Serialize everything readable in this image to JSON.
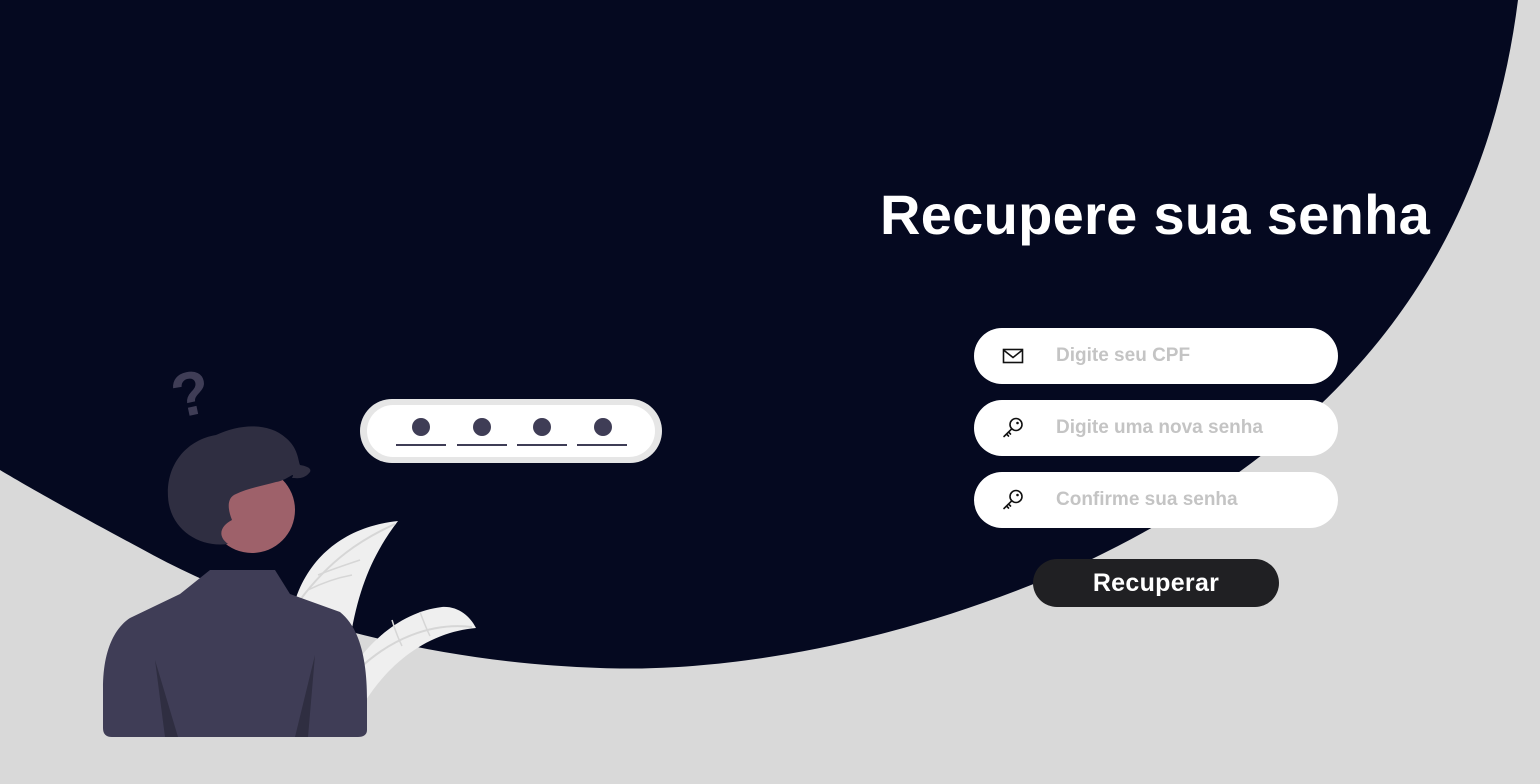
{
  "page": {
    "title": "Recupere sua senha"
  },
  "form": {
    "cpf_placeholder": "Digite seu CPF",
    "new_password_placeholder": "Digite uma nova senha",
    "confirm_password_placeholder": "Confirme sua senha",
    "submit_label": "Recuperar"
  },
  "icons": {
    "cpf": "mail-icon",
    "new_password": "key-icon",
    "confirm_password": "key-icon"
  },
  "illustration": {
    "pin_dots": 4,
    "question_mark": "?"
  },
  "colors": {
    "background": "#d9d9d9",
    "backdrop": "#050920",
    "button": "#202023",
    "field": "#ffffff",
    "placeholder": "#c4c4c4",
    "person_dark": "#3f3d56",
    "person_skin": "#9e616a"
  }
}
